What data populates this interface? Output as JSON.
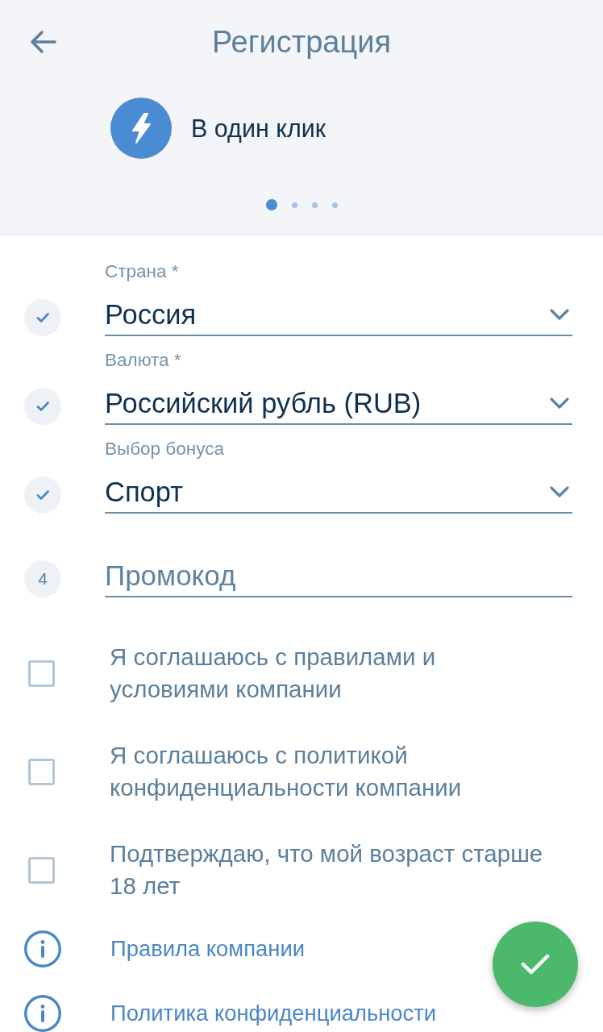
{
  "header": {
    "title": "Регистрация"
  },
  "method": {
    "label": "В один клик"
  },
  "pager": [
    {
      "selected": true
    },
    {
      "selected": false
    },
    {
      "selected": false
    },
    {
      "selected": false
    }
  ],
  "fields": [
    {
      "kind": "select",
      "label": "Страна *",
      "value": "Россия",
      "done": true
    },
    {
      "kind": "select",
      "label": "Валюта *",
      "value": "Российский рубль (RUB)",
      "done": true
    },
    {
      "kind": "select",
      "label": "Выбор бонуса",
      "value": "Спорт",
      "done": true
    },
    {
      "kind": "input",
      "step": "4",
      "placeholder": "Промокод",
      "done": false
    }
  ],
  "agreements": [
    {
      "text": "Я соглашаюсь с правилами и\nусловиями компании",
      "checked": false
    },
    {
      "text": "Я соглашаюсь с политикой\nконфиденциальности компании",
      "checked": false
    },
    {
      "text": "Подтверждаю, что мой возраст старше\n18 лет",
      "checked": false
    }
  ],
  "links": [
    {
      "label": "Правила компании"
    },
    {
      "label": "Политика конфиденциальности"
    }
  ]
}
